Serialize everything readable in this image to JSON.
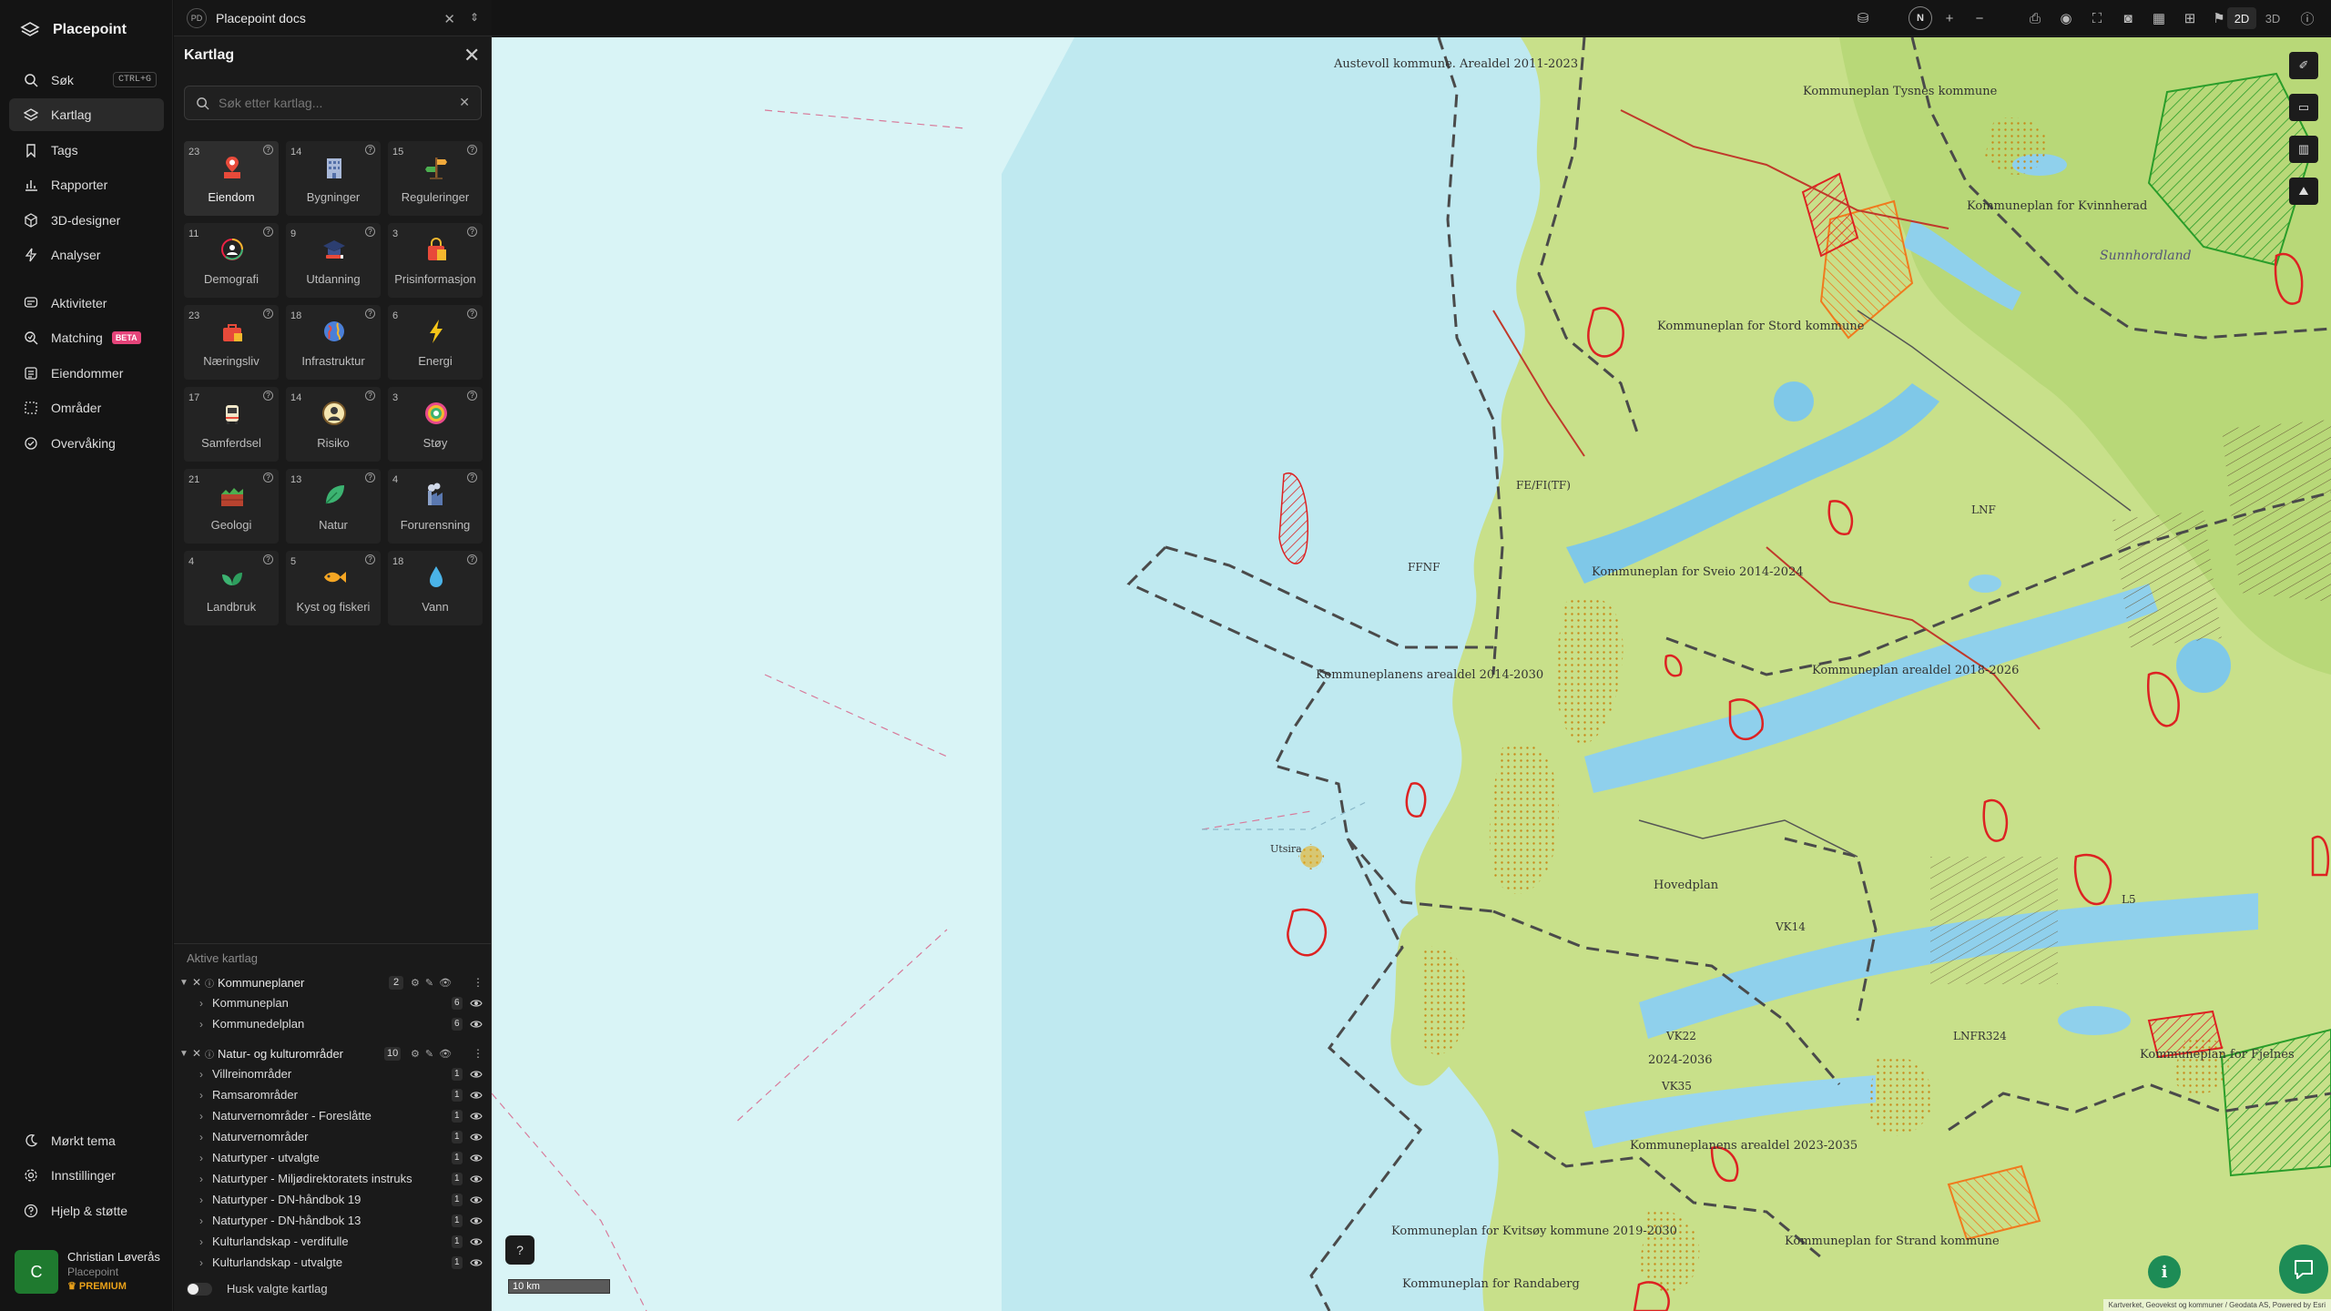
{
  "brand": {
    "name": "Placepoint"
  },
  "nav": {
    "items": [
      {
        "label": "Søk",
        "icon": "search-icon",
        "shortcut": "CTRL+G"
      },
      {
        "label": "Kartlag",
        "icon": "layers-icon",
        "active": true
      },
      {
        "label": "Tags",
        "icon": "bookmark-icon"
      },
      {
        "label": "Rapporter",
        "icon": "bar-chart-icon"
      },
      {
        "label": "3D-designer",
        "icon": "cube-icon"
      },
      {
        "label": "Analyser",
        "icon": "lightning-icon"
      },
      {
        "label": "Aktiviteter",
        "icon": "chat-icon"
      },
      {
        "label": "Matching",
        "icon": "match-icon",
        "badge": "BETA"
      },
      {
        "label": "Eiendommer",
        "icon": "building-list-icon"
      },
      {
        "label": "Områder",
        "icon": "area-icon"
      },
      {
        "label": "Overvåking",
        "icon": "monitor-icon"
      }
    ],
    "bottom": [
      {
        "label": "Mørkt tema",
        "icon": "moon-icon"
      },
      {
        "label": "Innstillinger",
        "icon": "gear-icon"
      },
      {
        "label": "Hjelp & støtte",
        "icon": "help-icon"
      }
    ],
    "user": {
      "initial": "C",
      "name": "Christian Løverås",
      "org": "Placepoint",
      "plan": "PREMIUM"
    }
  },
  "tab": {
    "badge": "PD",
    "title": "Placepoint docs"
  },
  "panel": {
    "title": "Kartlag",
    "search_placeholder": "Søk etter kartlag...",
    "categories": [
      {
        "count": "23",
        "label": "Eiendom",
        "icon": "property-pin-icon",
        "active": true
      },
      {
        "count": "14",
        "label": "Bygninger",
        "icon": "buildings-icon"
      },
      {
        "count": "15",
        "label": "Reguleringer",
        "icon": "signpost-icon"
      },
      {
        "count": "11",
        "label": "Demografi",
        "icon": "demography-icon"
      },
      {
        "count": "9",
        "label": "Utdanning",
        "icon": "graduation-cap-icon"
      },
      {
        "count": "3",
        "label": "Prisinformasjon",
        "icon": "shopping-bag-icon"
      },
      {
        "count": "23",
        "label": "Næringsliv",
        "icon": "business-bag-icon"
      },
      {
        "count": "18",
        "label": "Infrastruktur",
        "icon": "globe-icon"
      },
      {
        "count": "6",
        "label": "Energi",
        "icon": "lightning-bolt-icon"
      },
      {
        "count": "17",
        "label": "Samferdsel",
        "icon": "bus-icon"
      },
      {
        "count": "14",
        "label": "Risiko",
        "icon": "risk-icon"
      },
      {
        "count": "3",
        "label": "Støy",
        "icon": "noise-icon"
      },
      {
        "count": "21",
        "label": "Geologi",
        "icon": "geology-icon"
      },
      {
        "count": "13",
        "label": "Natur",
        "icon": "leaf-icon"
      },
      {
        "count": "4",
        "label": "Forurensning",
        "icon": "factory-icon"
      },
      {
        "count": "4",
        "label": "Landbruk",
        "icon": "sprout-icon"
      },
      {
        "count": "5",
        "label": "Kyst og fiskeri",
        "icon": "fish-icon"
      },
      {
        "count": "18",
        "label": "Vann",
        "icon": "water-drop-icon"
      }
    ],
    "active_title": "Aktive kartlag",
    "groups": [
      {
        "name": "Kommuneplaner",
        "count": "2",
        "layers": [
          {
            "name": "Kommuneplan",
            "count": "6"
          },
          {
            "name": "Kommunedelplan",
            "count": "6"
          }
        ]
      },
      {
        "name": "Natur- og kulturområder",
        "count": "10",
        "layers": [
          {
            "name": "Villreinområder",
            "count": "1"
          },
          {
            "name": "Ramsarområder",
            "count": "1"
          },
          {
            "name": "Naturvernområder - Foreslåtte",
            "count": "1"
          },
          {
            "name": "Naturvernområder",
            "count": "1"
          },
          {
            "name": "Naturtyper - utvalgte",
            "count": "1"
          },
          {
            "name": "Naturtyper - Miljødirektoratets instruks",
            "count": "1"
          },
          {
            "name": "Naturtyper - DN-håndbok 19",
            "count": "1"
          },
          {
            "name": "Naturtyper - DN-håndbok 13",
            "count": "1"
          },
          {
            "name": "Kulturlandskap - verdifulle",
            "count": "1"
          },
          {
            "name": "Kulturlandskap - utvalgte",
            "count": "1"
          }
        ]
      }
    ],
    "remember_label": "Husk valgte kartlag"
  },
  "topbar": {
    "north": "N",
    "dim_2d": "2D",
    "dim_3d": "3D"
  },
  "map": {
    "labels": [
      "Austevoll kommune. Arealdel 2011-2023",
      "Kommuneplan Tysnes kommune",
      "Kommuneplan for Stord kommune",
      "Kommuneplan for Sveio 2014-2024",
      "Kommuneplanens arealdel 2014-2030",
      "Kommuneplan arealdel 2018-2026",
      "Kommuneplan for Kvinnherad",
      "Kommuneplan for Fjelnes",
      "Kommuneplan for Kvitsøy kommune 2019-2030",
      "Kommuneplanens arealdel 2023-2035",
      "Kommuneplan for Strand kommune",
      "Kommuneplan for Randaberg",
      "Utsira",
      "Hovedplan",
      "2024-2036",
      "FE/FI(TF)",
      "FFNF",
      "LNF",
      "VK14",
      "VK22",
      "VK35",
      "LNFR324",
      "L5",
      "Sunnhordland"
    ],
    "scale_label": "10 km",
    "attribution": "Kartverket, Geovekst og kommuner / Geodata AS, Powered by Esri"
  },
  "colors": {
    "accent_green": "#1d8c56",
    "beta_badge": "#e5447a",
    "premium": "#e8a019",
    "sea": "#d9f4f6",
    "land": "#c8e08a"
  }
}
